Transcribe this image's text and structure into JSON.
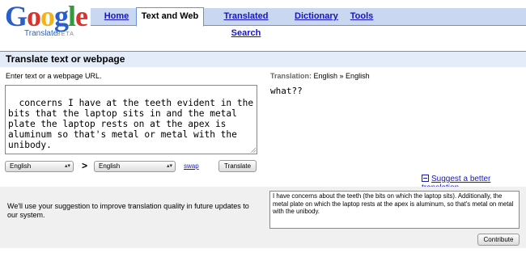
{
  "logo": {
    "wordmark": [
      "G",
      "o",
      "o",
      "g",
      "l",
      "e"
    ],
    "product": "Translate",
    "badge": "BETA"
  },
  "tabs": [
    {
      "label": "Home",
      "active": false
    },
    {
      "label": "Text and Web",
      "active": true
    },
    {
      "label": "Translated Search",
      "active": false
    },
    {
      "label": "Dictionary",
      "active": false
    },
    {
      "label": "Tools",
      "active": false
    }
  ],
  "section": {
    "title": "Translate text or webpage"
  },
  "source": {
    "label": "Enter text or a webpage URL.",
    "text": "concerns I have at the teeth evident in the\nbits that the laptop sits in and the metal\nplate the laptop rests on at the apex is\naluminum so that's metal or metal with the\nunibody."
  },
  "translation": {
    "label_key": "Translation:",
    "label_value": "English » English",
    "result": "what??"
  },
  "controls": {
    "from_lang": "English",
    "to_lang": "English",
    "arrow": ">",
    "swap_label": "swap",
    "translate_label": "Translate"
  },
  "suggest": {
    "link": "Suggest a better translation",
    "note": "We'll use your suggestion to improve translation quality in future updates to our system.",
    "suggestion_text": "I have concerns about the teeth (the bits on which the laptop sits). Additionally, the metal plate on which the laptop rests at the apex is aluminum, so that's metal on metal with the unibody.",
    "contribute_label": "Contribute"
  },
  "colors": {
    "tab_bar": "#c9d7f1",
    "tab_border": "#6b90da",
    "section_bg": "#e5ecf9",
    "link": "#1515c5",
    "panel_bg": "#f0f0f0"
  }
}
